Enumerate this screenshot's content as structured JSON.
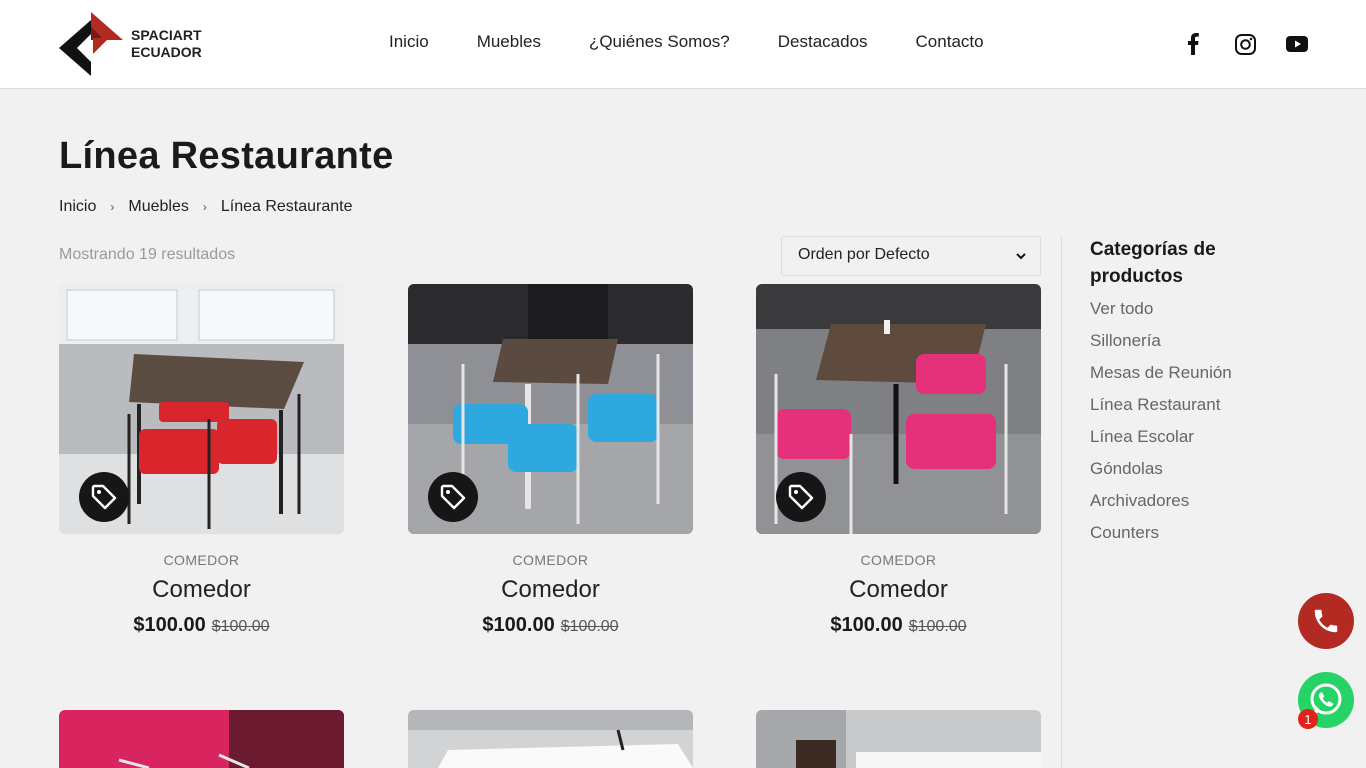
{
  "brand": {
    "line1": "SPACIART",
    "line2": "ECUADOR",
    "accent": "#b32a23"
  },
  "nav": {
    "items": [
      {
        "label": "Inicio"
      },
      {
        "label": "Muebles"
      },
      {
        "label": "¿Quiénes Somos?"
      },
      {
        "label": "Destacados"
      },
      {
        "label": "Contacto"
      }
    ]
  },
  "social": {
    "icons": [
      "facebook-icon",
      "instagram-icon",
      "youtube-icon"
    ]
  },
  "page": {
    "title": "Línea Restaurante"
  },
  "breadcrumb": {
    "items": [
      "Inicio",
      "Muebles",
      "Línea Restaurante"
    ]
  },
  "shop": {
    "results_text": "Mostrando 19 resultados",
    "sort_selected": "Orden por Defecto"
  },
  "products": [
    {
      "category": "COMEDOR",
      "name": "Comedor",
      "price": "$100.00",
      "old_price": "$100.00",
      "seat_color": "#d9262c"
    },
    {
      "category": "COMEDOR",
      "name": "Comedor",
      "price": "$100.00",
      "old_price": "$100.00",
      "seat_color": "#2fa8e0"
    },
    {
      "category": "COMEDOR",
      "name": "Comedor",
      "price": "$100.00",
      "old_price": "$100.00",
      "seat_color": "#e5307a"
    }
  ],
  "sidebar": {
    "title": "Categorías de productos",
    "items": [
      "Ver todo",
      "Sillonería",
      "Mesas de Reunión",
      "Línea Restaurant",
      "Línea Escolar",
      "Góndolas",
      "Archivadores",
      "Counters"
    ]
  },
  "floating": {
    "whatsapp_badge": "1",
    "phone_color": "#b32a23",
    "whatsapp_color": "#25d366"
  }
}
